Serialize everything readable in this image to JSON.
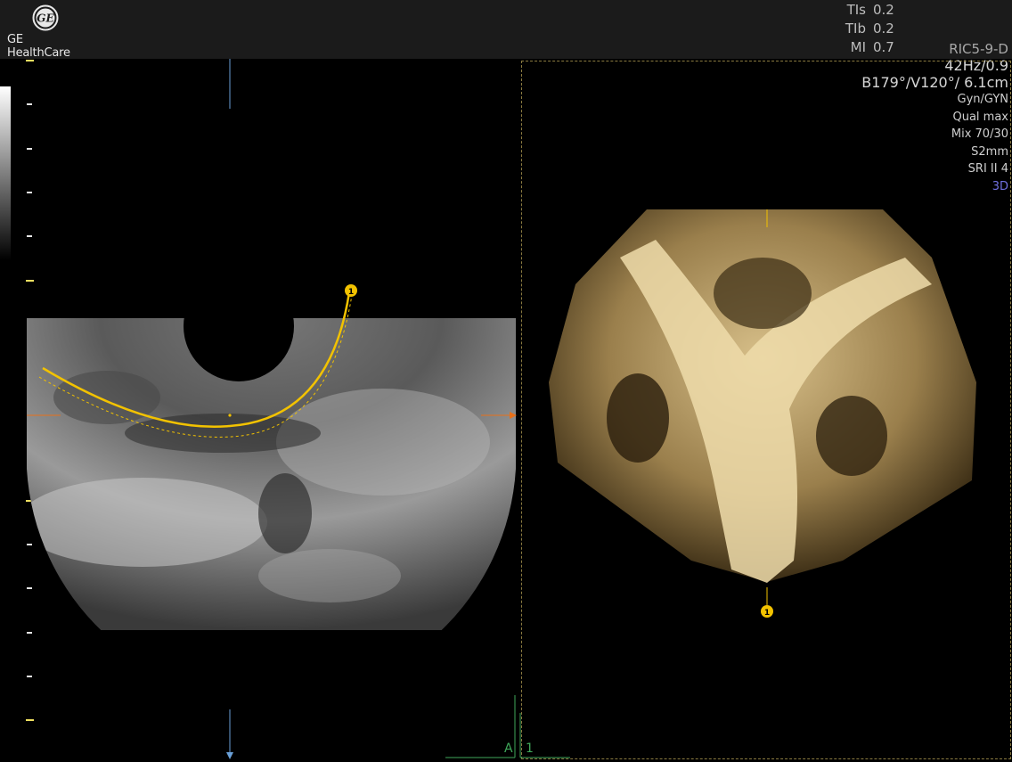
{
  "header": {
    "brand": "GE HealthCare",
    "logo_icon": "ge-monogram-icon",
    "safety": [
      {
        "key": "TIs",
        "value": "0.2"
      },
      {
        "key": "TIb",
        "value": "0.2"
      },
      {
        "key": "MI",
        "value": "0.7"
      }
    ]
  },
  "params": {
    "probe": "RIC5-9-D",
    "frame_rate": "42Hz/0.9",
    "volume": "B179°/V120°/ 6.1cm",
    "preset": "Gyn/GYN",
    "quality": "Qual max",
    "mix": "Mix 70/30",
    "slice": "S2mm",
    "sri": "SRI II 4",
    "mode": "3D"
  },
  "markers": {
    "curve_marker": "1",
    "render_marker": "1",
    "ref_a": "A",
    "ref_1": "1"
  },
  "colors": {
    "accent_yellow": "#f2c200",
    "cursor_orange": "#e8701a",
    "cursor_blue": "#6aa0d8",
    "ref_green": "#3fa85a"
  }
}
